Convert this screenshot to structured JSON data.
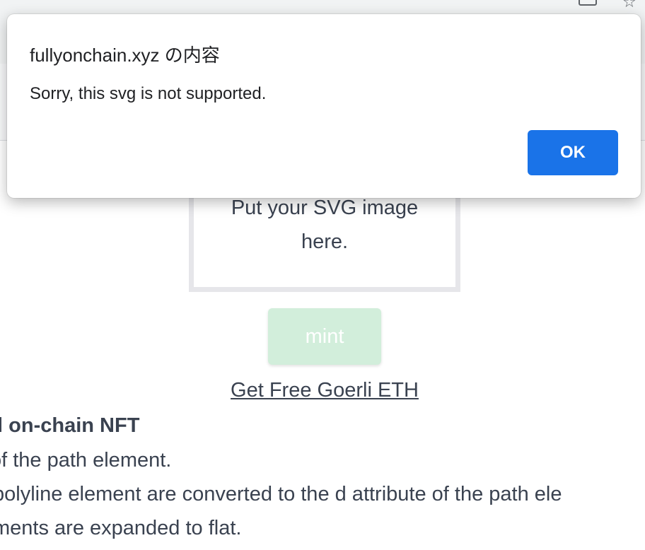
{
  "dialog": {
    "title": "fullyonchain.xyz の内容",
    "message": "Sorry, this svg is not supported.",
    "ok_label": "OK"
  },
  "page": {
    "drop_zone_text": "Put your SVG image here.",
    "mint_label": "mint",
    "faucet_link": "Get Free Goerli ETH",
    "section_heading": "ll on-chain NFT",
    "desc_lines": [
      "of the path element.",
      "polyline element are converted to the d attribute of the path ele",
      "ments are expanded to flat."
    ]
  },
  "colors": {
    "accent": "#1a73e8",
    "text": "#3a4250",
    "mint_disabled": "#d2eedb"
  }
}
